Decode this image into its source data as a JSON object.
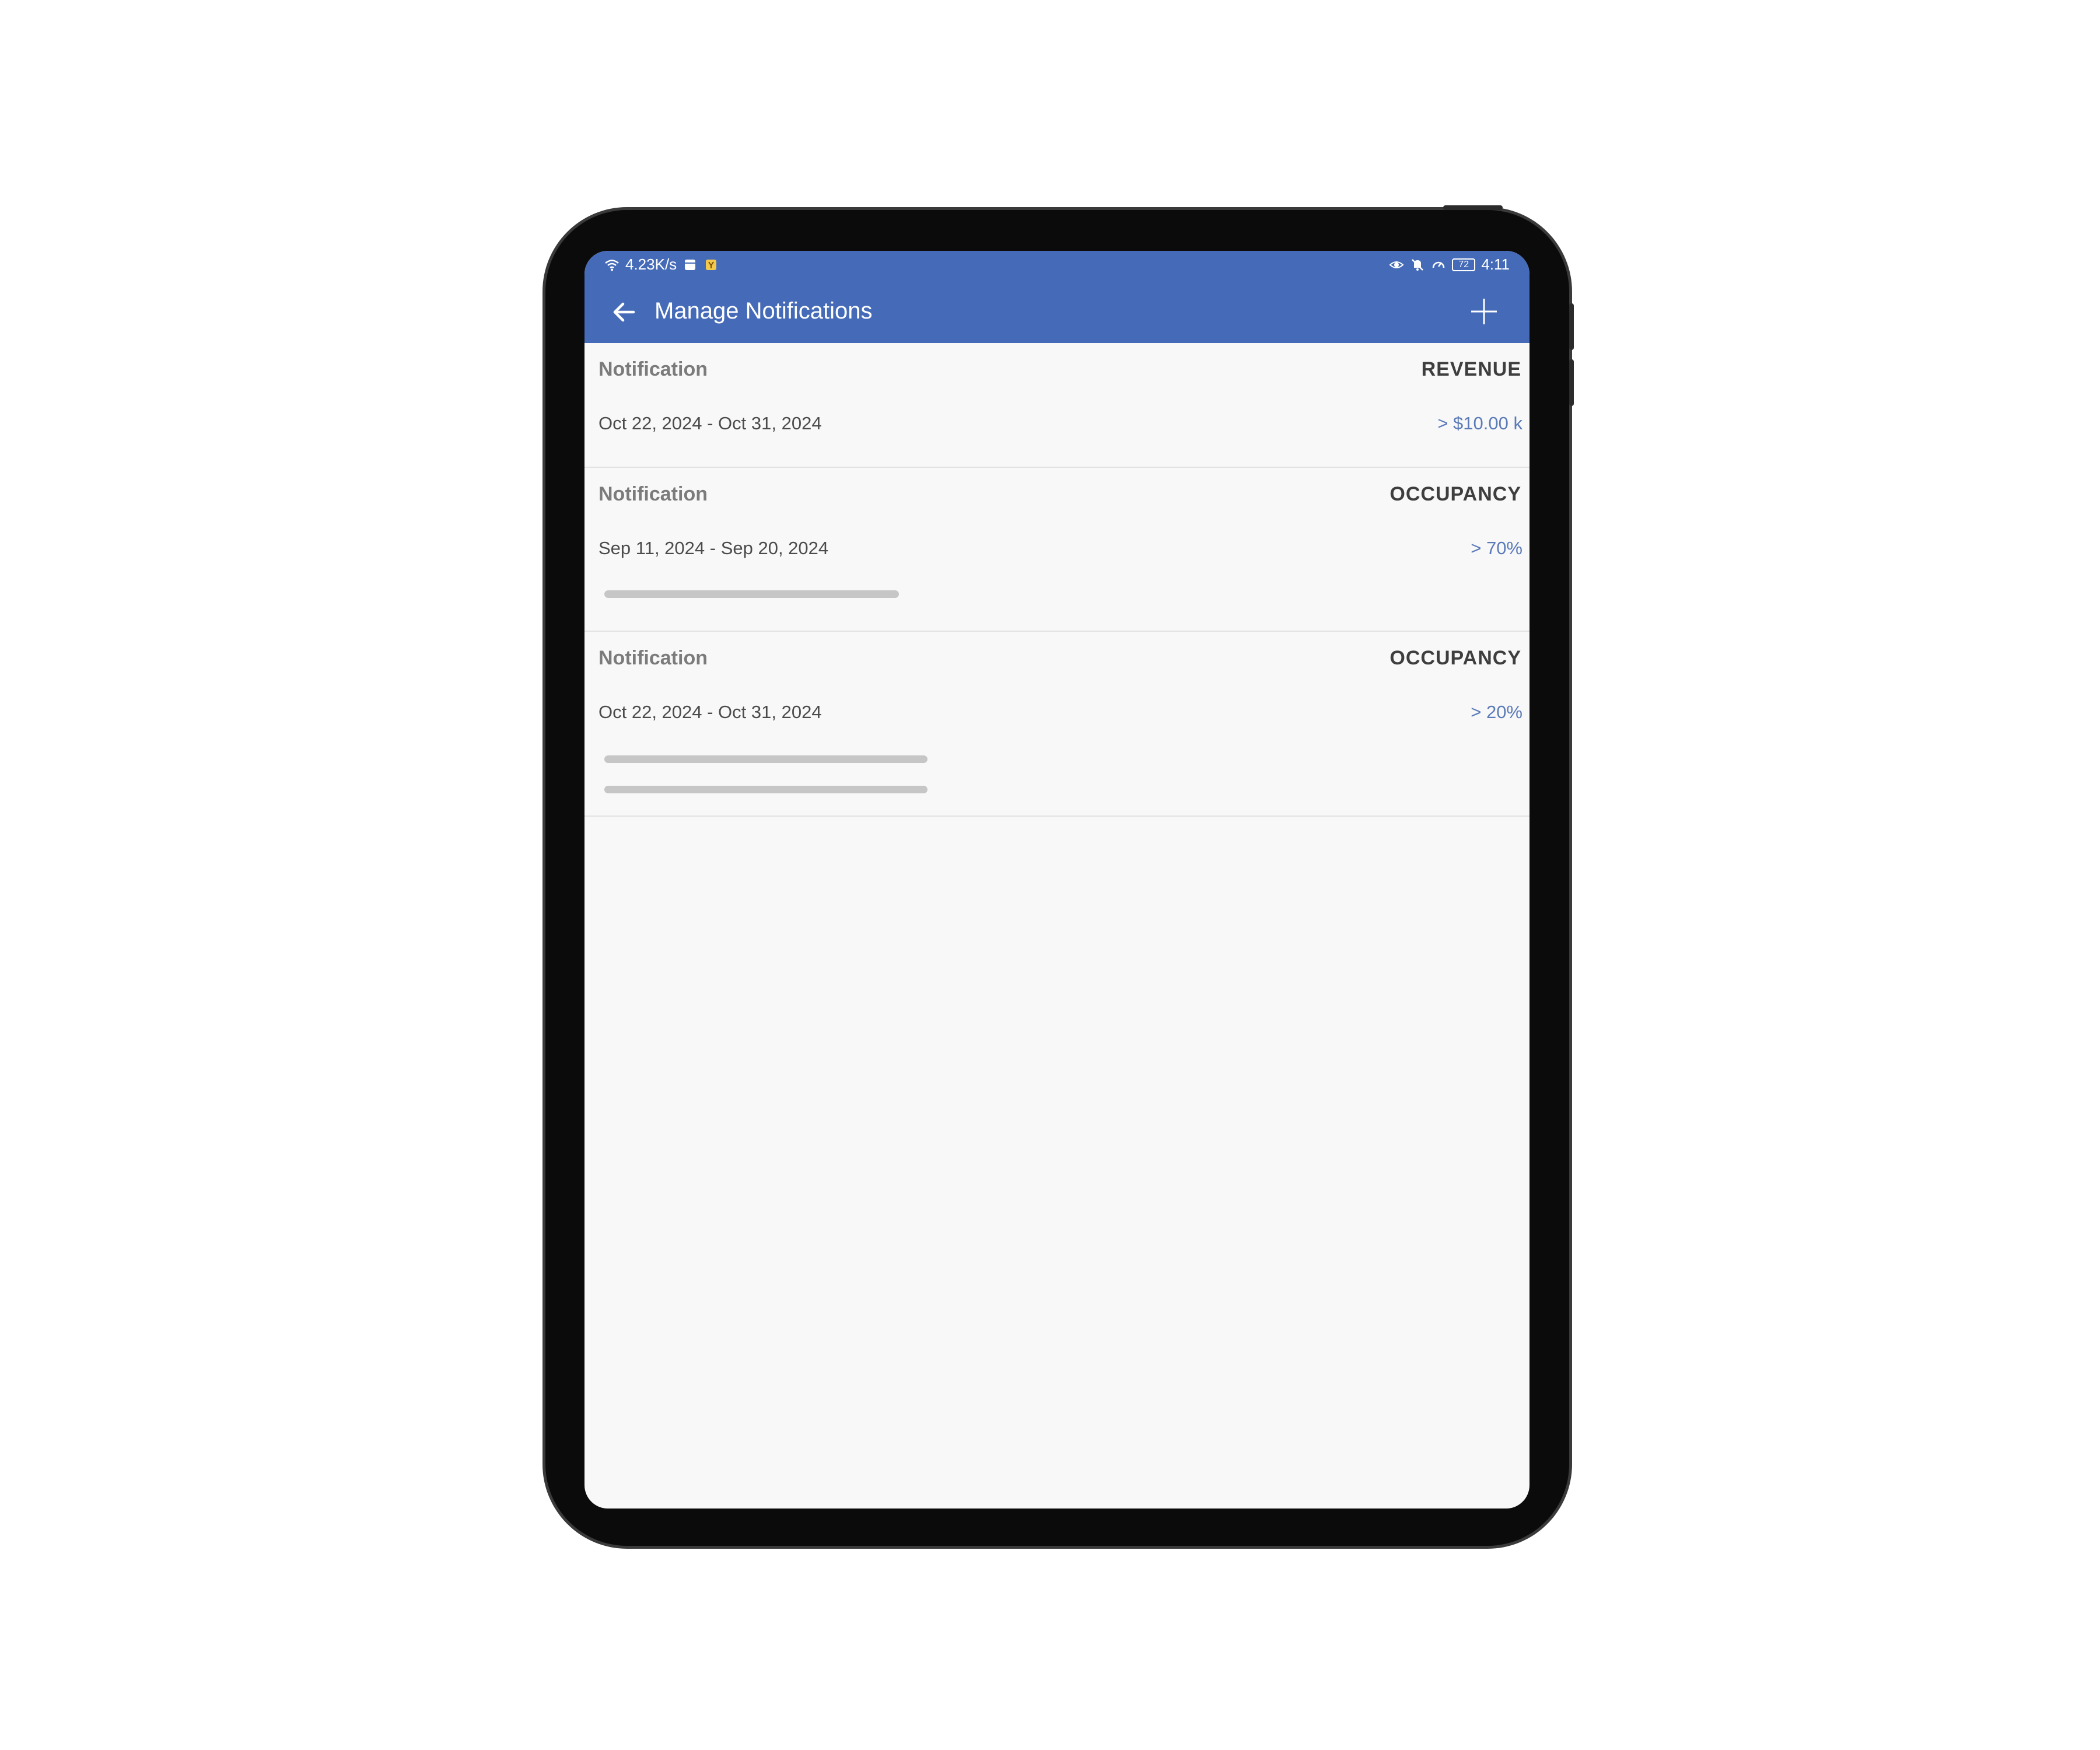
{
  "status_bar": {
    "network_speed": "4.23K/s",
    "battery_level": "72",
    "time": "4:11",
    "left_icons": [
      "wifi-icon",
      "sim-card-icon",
      "app-notification-icon"
    ],
    "right_icons": [
      "eye-icon",
      "bell-off-icon",
      "speedometer-icon",
      "battery-icon"
    ]
  },
  "app_bar": {
    "title": "Manage Notifications",
    "back_icon": "arrow-left-icon",
    "add_icon": "plus-icon",
    "background_color": "#456bb8"
  },
  "notifications": [
    {
      "label": "Notification",
      "type": "REVENUE",
      "date_range": "Oct 22, 2024 - Oct 31, 2024",
      "threshold": "> $10.00 k"
    },
    {
      "label": "Notification",
      "type": "OCCUPANCY",
      "date_range": "Sep 11, 2024 - Sep 20, 2024",
      "threshold": "> 70%"
    },
    {
      "label": "Notification",
      "type": "OCCUPANCY",
      "date_range": "Oct 22, 2024 - Oct 31, 2024",
      "threshold": "> 20%"
    }
  ],
  "colors": {
    "accent": "#456bb8",
    "threshold_text": "#5a7ab8",
    "screen_background": "#f8f8f8"
  }
}
